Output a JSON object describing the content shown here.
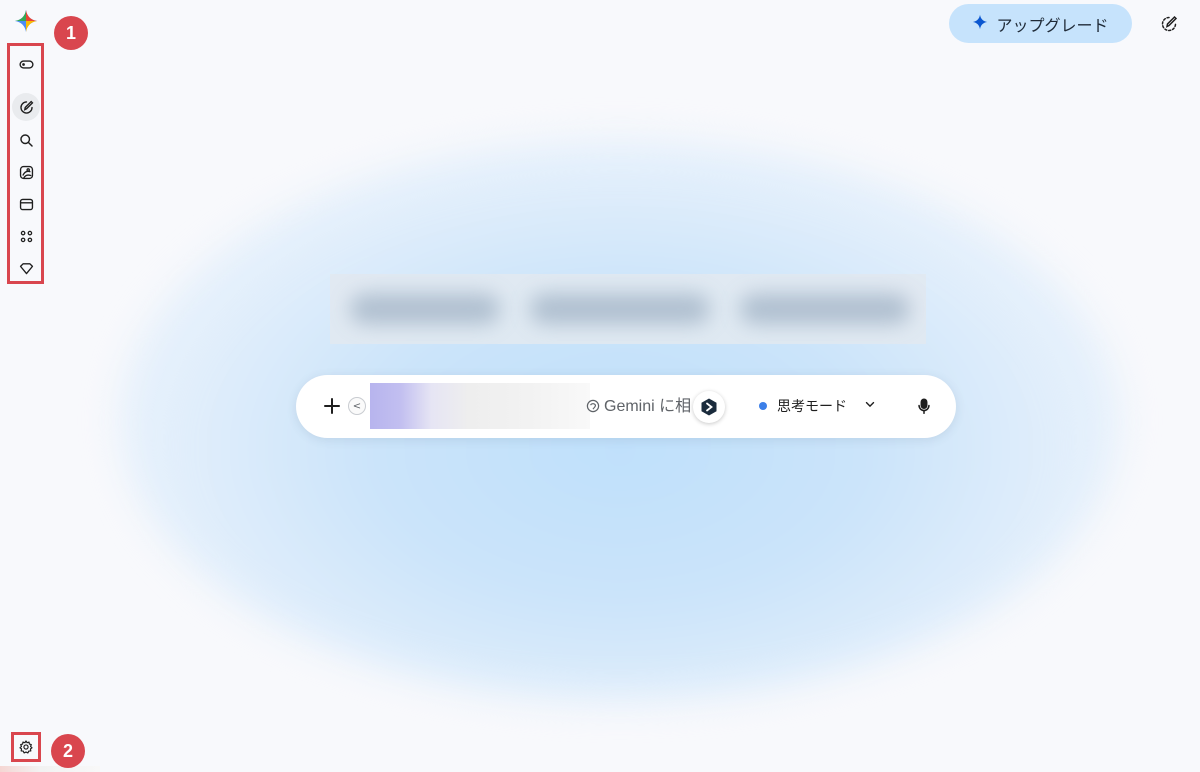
{
  "sidebar": {
    "items": [
      {
        "name": "sidebar-toggle",
        "icon": "toggle-icon"
      },
      {
        "name": "new-chat",
        "icon": "edit-icon"
      },
      {
        "name": "search",
        "icon": "search-icon"
      },
      {
        "name": "image",
        "icon": "image-icon"
      },
      {
        "name": "canvas",
        "icon": "canvas-icon"
      },
      {
        "name": "apps",
        "icon": "apps-icon"
      },
      {
        "name": "gems",
        "icon": "diamond-icon"
      }
    ],
    "settings_icon": "gear-icon"
  },
  "annotations": {
    "badge_1": "1",
    "badge_2": "2",
    "color": "#d9464e"
  },
  "header": {
    "upgrade_label": "アップグレード",
    "upgrade_icon": "sparkle-icon",
    "edit_icon": "edit-chat-icon"
  },
  "composer": {
    "placeholder": "Gemini に相",
    "mode_label": "思考モード",
    "mode_dot_color": "#3c7fe8",
    "icons": [
      "plus-icon",
      "chevron-left-icon",
      "prompt-icon",
      "extension-icon",
      "chevron-down-icon",
      "mic-icon"
    ]
  },
  "colors": {
    "background": "#f8f9fc",
    "glow": "#bfe0fb",
    "upgrade_bg": "#c6e3fc"
  }
}
